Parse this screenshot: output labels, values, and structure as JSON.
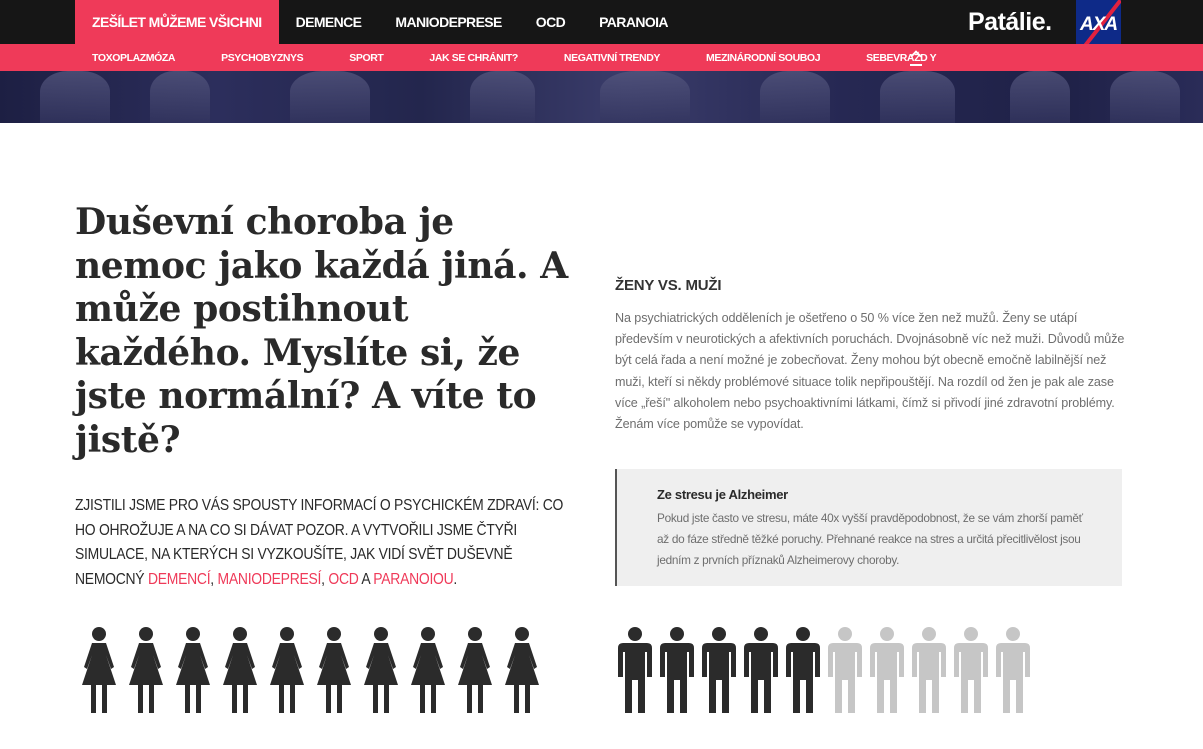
{
  "topnav": {
    "tabs": [
      {
        "label": "Zešílet můžeme všichni",
        "active": true
      },
      {
        "label": "Demence",
        "active": false
      },
      {
        "label": "Maniodeprese",
        "active": false
      },
      {
        "label": "OCD",
        "active": false
      },
      {
        "label": "Paranoia",
        "active": false
      }
    ],
    "logo": "Patálie.",
    "sponsor": "AXA"
  },
  "subnav": {
    "items": [
      "Toxoplazmóza",
      "Psychobyznys",
      "Sport",
      "Jak se chránit?",
      "Negativní trendy",
      "Mezinárodní souboj",
      "Sebevražd y"
    ]
  },
  "headline": "Duševní choroba je nemoc jako každá jiná. A může postihnout každého. Myslíte si, že jste normální? A víte to jistě?",
  "lead": {
    "text": "Zjistili jsme pro vás spousty informací o psychickém zdraví: co ho ohrožuje a na co si dávat pozor. A vytvořili jsme čtyři simulace, na kterých si vyzkoušíte, jak vidí svět duševně nemocný",
    "links": [
      "demencí",
      "maniodepresí",
      "OCD",
      "paranoiou"
    ],
    "sep1": ",",
    "sep2": ",",
    "and": "a",
    "end": "."
  },
  "section": {
    "title": "Ženy vs. muži",
    "body": "Na psychiatrických odděleních je ošetřeno o 50 % více žen než mužů. Ženy se utápí především v neurotických a afektivních poruchách. Dvojnásobně víc než muži. Důvodů může být celá řada a není možné je zobecňovat. Ženy mohou být obecně emočně labilnější než muži, kteří si někdy problémové situace tolik nepřipouštějí. Na rozdíl od žen je pak ale zase více „řeší\" alkoholem nebo psychoaktivními látkami, čímž si přivodí jiné zdravotní problémy. Ženám více pomůže se vypovídat."
  },
  "callout": {
    "title": "Ze stresu je Alzheimer",
    "body": "Pokud jste často ve stresu, máte 40x vyšší pravděpodobnost, že se vám zhorší paměť až do fáze středně těžké poruchy. Přehnané reakce na stres a určitá přecitlivělost jsou jedním z prvních příznaků Alzheimerovy choroby."
  },
  "pictograms": {
    "women_total": 10,
    "women_filled": 10,
    "men_total": 10,
    "men_filled": 5,
    "filled_color": "#2b2b2b",
    "empty_color": "#c6c6c6"
  },
  "colors": {
    "accent": "#ef3a59",
    "topbar": "#161616",
    "sponsor_blue": "#0e2a88"
  }
}
